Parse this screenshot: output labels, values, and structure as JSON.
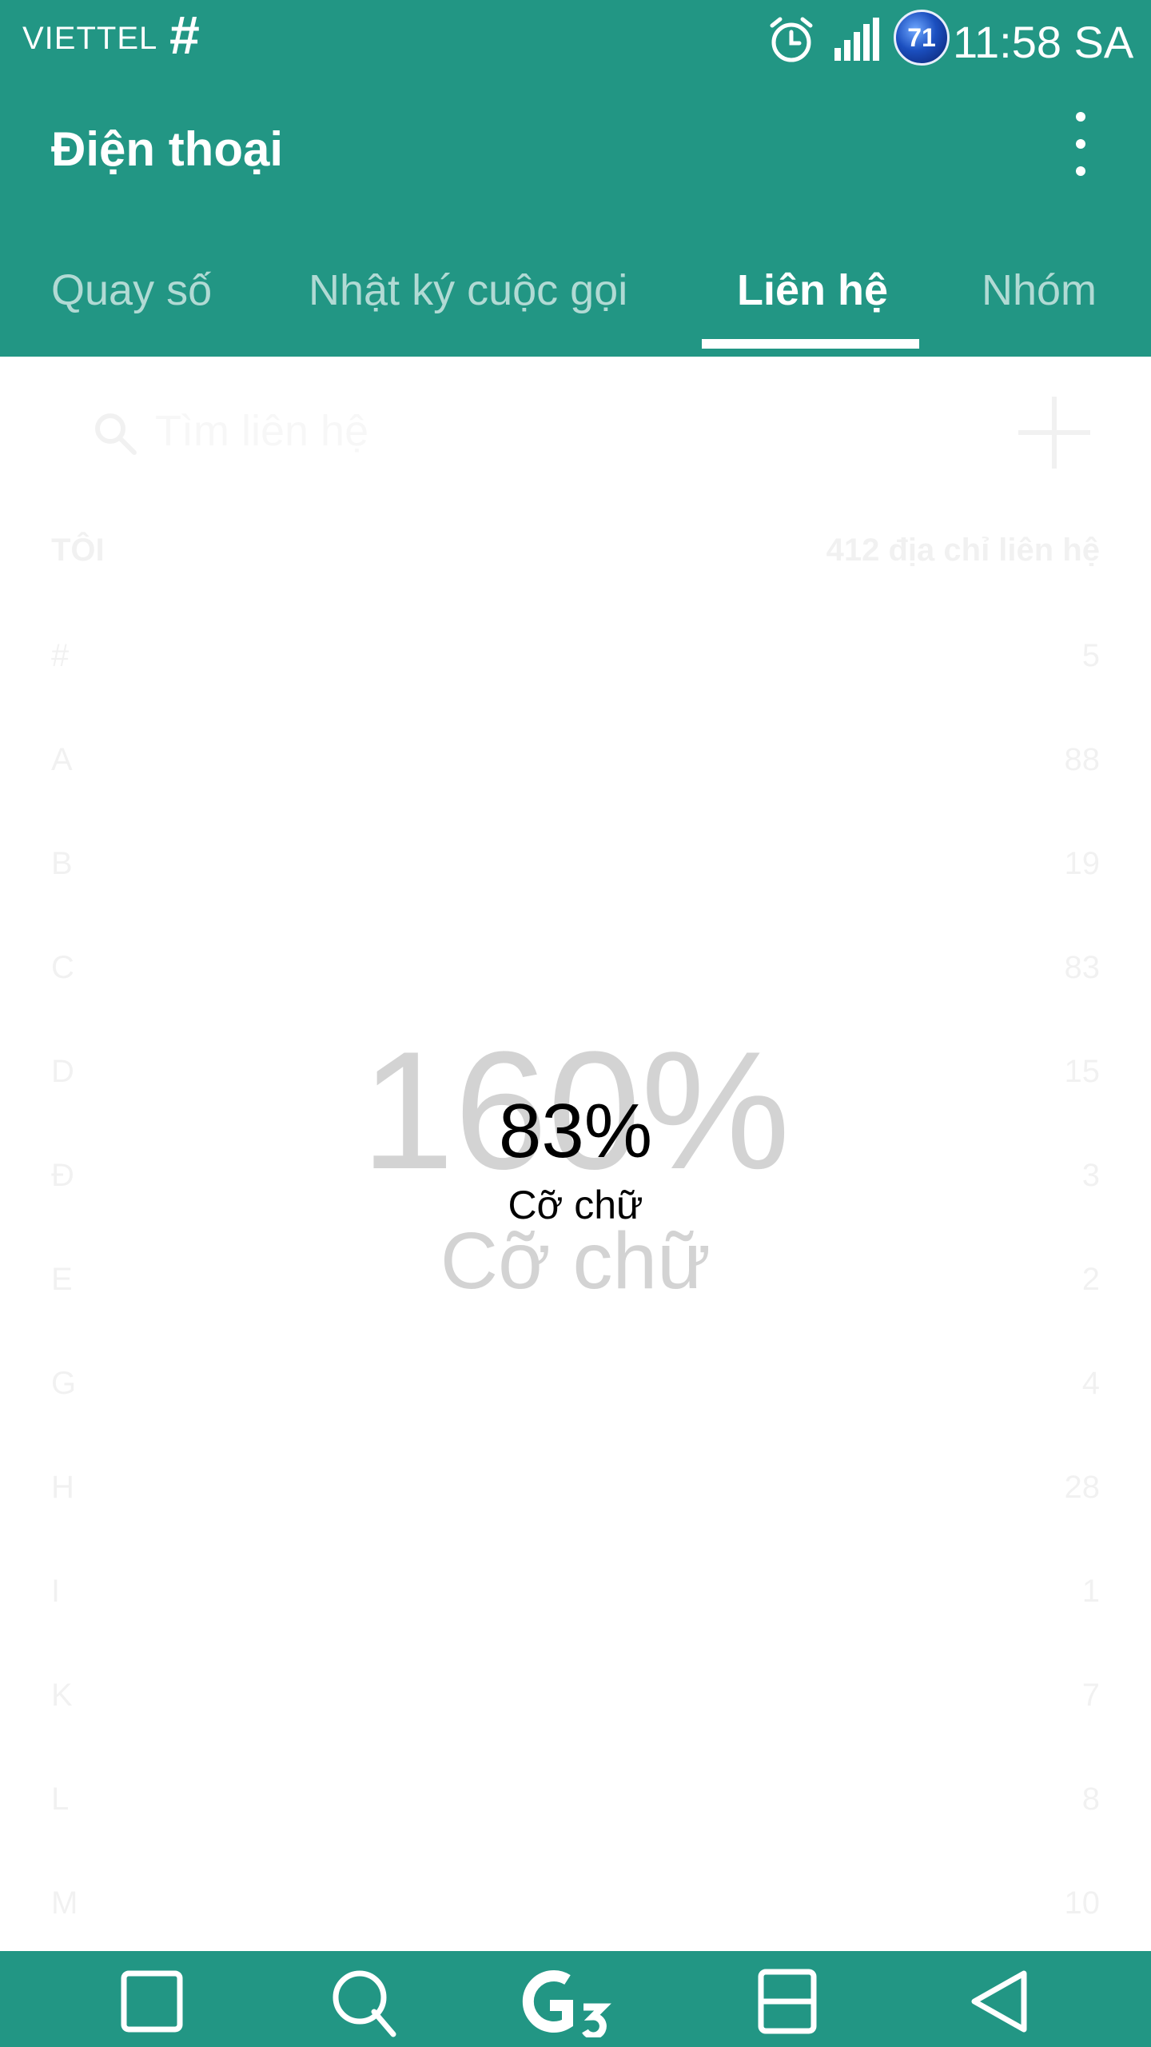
{
  "status_bar": {
    "carrier": "VIETTEL",
    "hash": "#",
    "badge": "71",
    "time": "11:58 SA",
    "icons": [
      "alarm-icon",
      "signal-icon"
    ]
  },
  "app_bar": {
    "title": "Điện thoại",
    "tabs": [
      {
        "label": "Quay số",
        "active": false
      },
      {
        "label": "Nhật ký cuộc gọi",
        "active": false
      },
      {
        "label": "Liên hệ",
        "active": true
      },
      {
        "label": "Nhóm",
        "active": false
      }
    ]
  },
  "contacts": {
    "search_placeholder": "Tìm liên hệ",
    "me_label": "TÔI",
    "total_label": "412 địa chỉ liên hệ",
    "index": [
      {
        "letter": "#",
        "count": "5"
      },
      {
        "letter": "A",
        "count": "88"
      },
      {
        "letter": "B",
        "count": "19"
      },
      {
        "letter": "C",
        "count": "83"
      },
      {
        "letter": "D",
        "count": "15"
      },
      {
        "letter": "Đ",
        "count": "3"
      },
      {
        "letter": "E",
        "count": "2"
      },
      {
        "letter": "G",
        "count": "4"
      },
      {
        "letter": "H",
        "count": "28"
      },
      {
        "letter": "I",
        "count": "1"
      },
      {
        "letter": "K",
        "count": "7"
      },
      {
        "letter": "L",
        "count": "8"
      },
      {
        "letter": "M",
        "count": "10"
      }
    ]
  },
  "text_size": {
    "ghost_value": "160%",
    "ghost_label": "Cỡ chữ",
    "value": "83%",
    "label": "Cỡ chữ"
  },
  "colors": {
    "primary": "#229684",
    "ghost_text": "#d3d3d3"
  }
}
